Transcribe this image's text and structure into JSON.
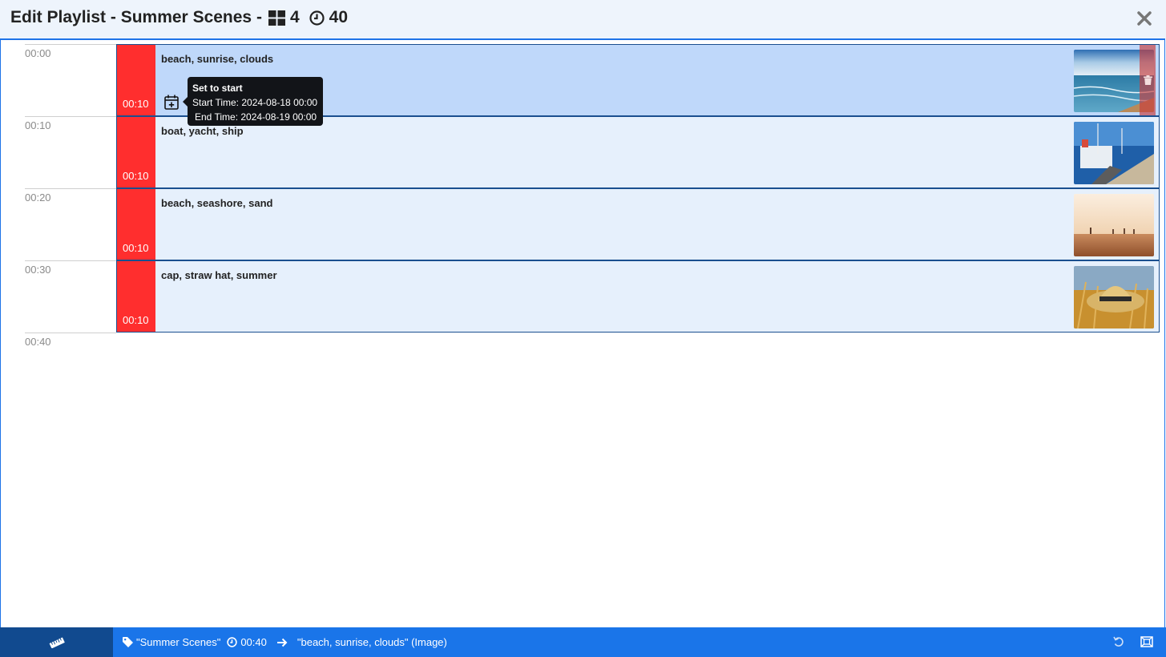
{
  "header": {
    "title": "Edit Playlist - Summer Scenes -",
    "item_count": "4",
    "total_duration": "40",
    "close_icon": "close-icon"
  },
  "timeline": {
    "labels": [
      "00:00",
      "00:10",
      "00:20",
      "00:30",
      "00:40"
    ]
  },
  "items": [
    {
      "tags": "beach, sunrise, clouds",
      "duration": "00:10",
      "thumb": "beach-sunrise-image"
    },
    {
      "tags": "boat, yacht, ship",
      "duration": "00:10",
      "thumb": "boat-dock-image"
    },
    {
      "tags": "beach, seashore, sand",
      "duration": "00:10",
      "thumb": "sandy-beach-image"
    },
    {
      "tags": "cap, straw hat, summer",
      "duration": "00:10",
      "thumb": "straw-hat-image"
    }
  ],
  "tooltip": {
    "title": "Set to start",
    "start": "Start Time: 2024-08-18 00:00",
    "end": "End Time: 2024-08-19 00:00"
  },
  "footer": {
    "playlist": "\"Summer Scenes\"",
    "duration": "00:40",
    "selected": "\"beach, sunrise, clouds\" (Image)"
  },
  "colors": {
    "accent": "#1a75e9",
    "duration_bar": "#ff2e2e",
    "row_bg": "#e6f0fc",
    "row_selected": "#bfd8fa"
  }
}
